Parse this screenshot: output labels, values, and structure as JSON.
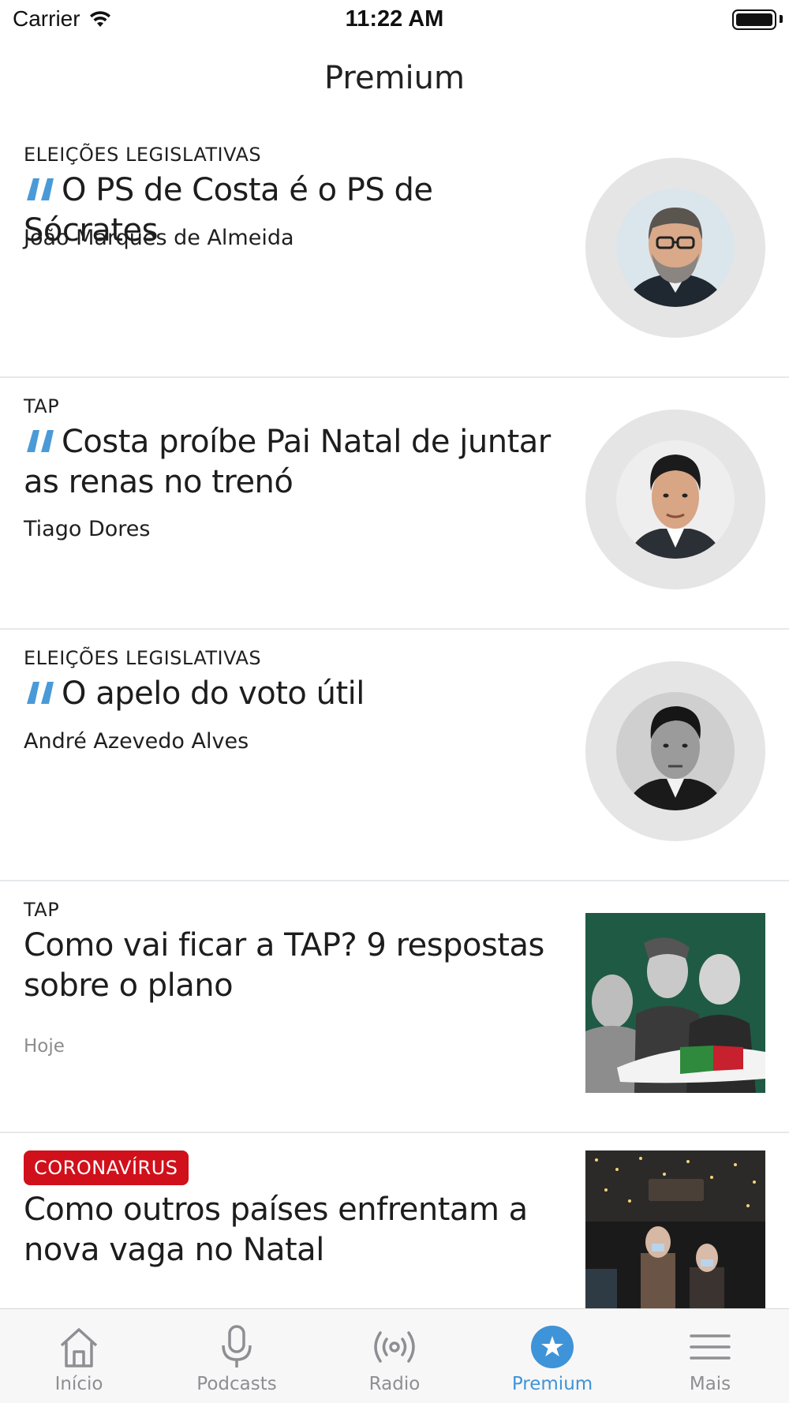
{
  "status_bar": {
    "carrier": "Carrier",
    "time": "11:22 AM"
  },
  "nav": {
    "title": "Premium"
  },
  "colors": {
    "accent": "#3f93d8",
    "quote_icon": "#4a9ad8",
    "badge_red": "#d0101b",
    "separator": "#e3e6e9",
    "muted_text": "#8c8c8c"
  },
  "articles": [
    {
      "category": "ELEIÇÕES LEGISLATIVAS",
      "headline": "O PS de Costa é o PS de Sócrates",
      "author": "João Marques de Almeida",
      "is_opinion": true,
      "image": "author-portrait"
    },
    {
      "category": "TAP",
      "headline": "Costa proíbe Pai Natal de juntar as renas no trenó",
      "author": "Tiago Dores",
      "is_opinion": true,
      "image": "author-portrait"
    },
    {
      "category": "ELEIÇÕES LEGISLATIVAS",
      "headline": "O apelo do voto útil",
      "author": "André Azevedo Alves",
      "is_opinion": true,
      "image": "author-portrait"
    },
    {
      "category": "TAP",
      "headline": "Como vai ficar a TAP? 9 respostas sobre o plano",
      "time": "Hoje",
      "is_opinion": false,
      "image": "article-photo"
    },
    {
      "category": "CORONAVÍRUS",
      "headline": "Como outros países enfrentam a nova vaga no Natal",
      "is_opinion": false,
      "badge": true,
      "image": "article-photo"
    }
  ],
  "tabs": [
    {
      "label": "Início",
      "icon": "house-icon",
      "active": false
    },
    {
      "label": "Podcasts",
      "icon": "microphone-icon",
      "active": false
    },
    {
      "label": "Radio",
      "icon": "radio-waves-icon",
      "active": false
    },
    {
      "label": "Premium",
      "icon": "star-icon",
      "active": true
    },
    {
      "label": "Mais",
      "icon": "menu-icon",
      "active": false
    }
  ]
}
